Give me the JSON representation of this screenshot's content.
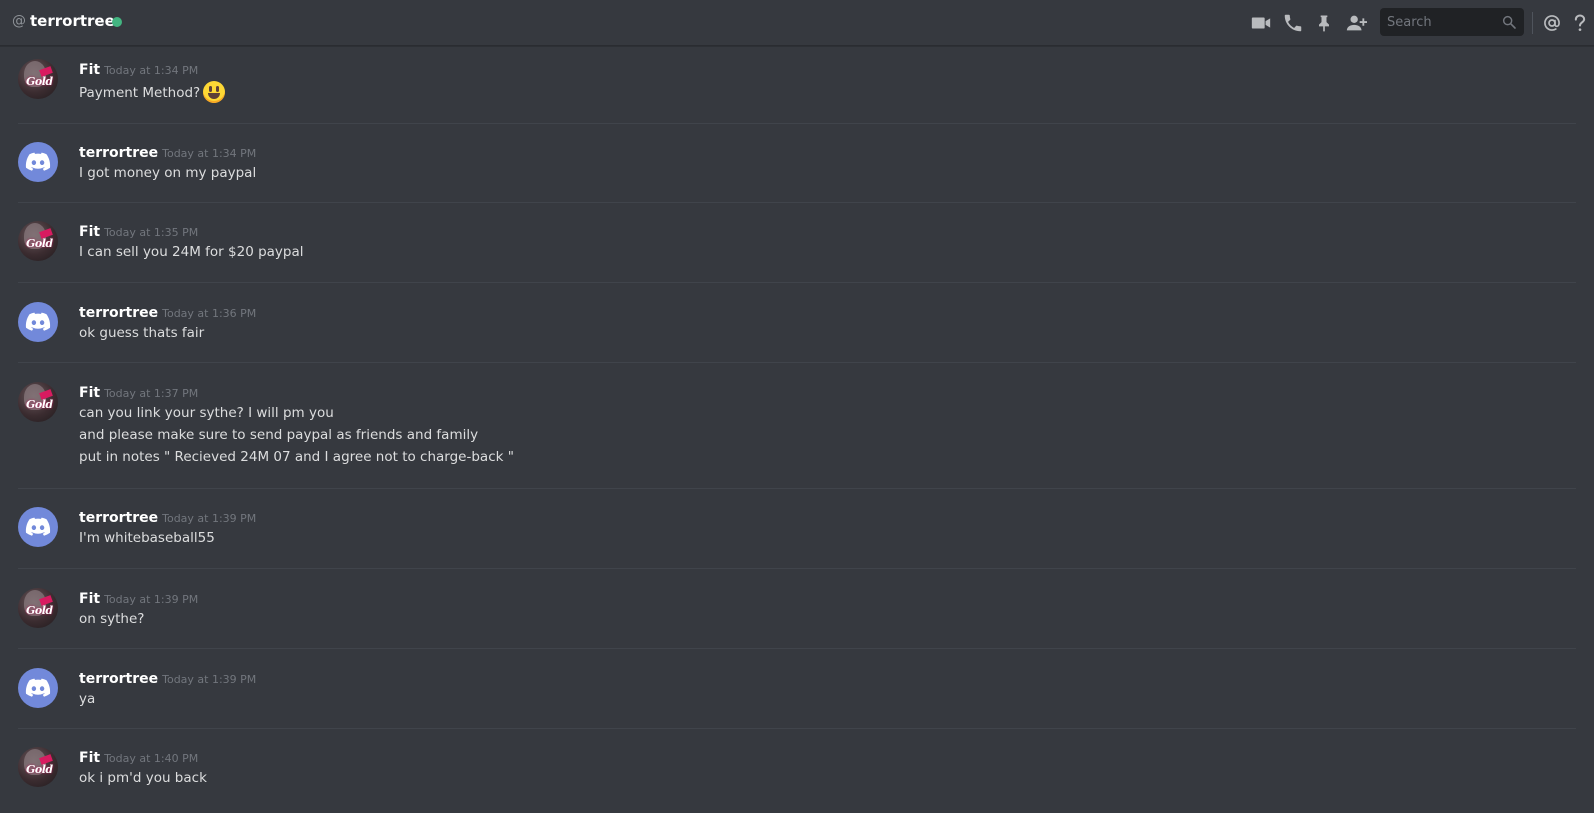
{
  "header": {
    "at_symbol": "@",
    "channel_name": "terrortree",
    "status_color": "#43b581",
    "search_placeholder": "Search",
    "icons": [
      "video-call-icon",
      "voice-call-icon",
      "pin-icon",
      "add-friend-icon",
      "search-icon",
      "mention-icon",
      "help-icon"
    ]
  },
  "messages": [
    {
      "author": "Fit",
      "time": "Today at 1:34 PM",
      "avatar": "fit-avatar",
      "lines": [
        "Payment Method?"
      ],
      "emoji": "smiley"
    },
    {
      "author": "terrortree",
      "time": "Today at 1:34 PM",
      "avatar": "discord-default-avatar",
      "lines": [
        "I got money on my paypal"
      ]
    },
    {
      "author": "Fit",
      "time": "Today at 1:35 PM",
      "avatar": "fit-avatar",
      "lines": [
        "I can sell you 24M for $20 paypal"
      ]
    },
    {
      "author": "terrortree",
      "time": "Today at 1:36 PM",
      "avatar": "discord-default-avatar",
      "lines": [
        "ok guess thats fair"
      ]
    },
    {
      "author": "Fit",
      "time": "Today at 1:37 PM",
      "avatar": "fit-avatar",
      "lines": [
        "can you link your sythe? I will pm you",
        "and please make sure to send paypal as friends and family",
        "put in notes \" Recieved 24M 07 and I agree not to charge-back \""
      ]
    },
    {
      "author": "terrortree",
      "time": "Today at 1:39 PM",
      "avatar": "discord-default-avatar",
      "lines": [
        "I'm whitebaseball55"
      ]
    },
    {
      "author": "Fit",
      "time": "Today at 1:39 PM",
      "avatar": "fit-avatar",
      "lines": [
        "on sythe?"
      ]
    },
    {
      "author": "terrortree",
      "time": "Today at 1:39 PM",
      "avatar": "discord-default-avatar",
      "lines": [
        "ya"
      ]
    },
    {
      "author": "Fit",
      "time": "Today at 1:40 PM",
      "avatar": "fit-avatar",
      "lines": [
        "ok i pm'd you back"
      ]
    }
  ],
  "colors": {
    "background": "#36393f",
    "discord_blurple": "#7289da",
    "online_green": "#43b581"
  }
}
